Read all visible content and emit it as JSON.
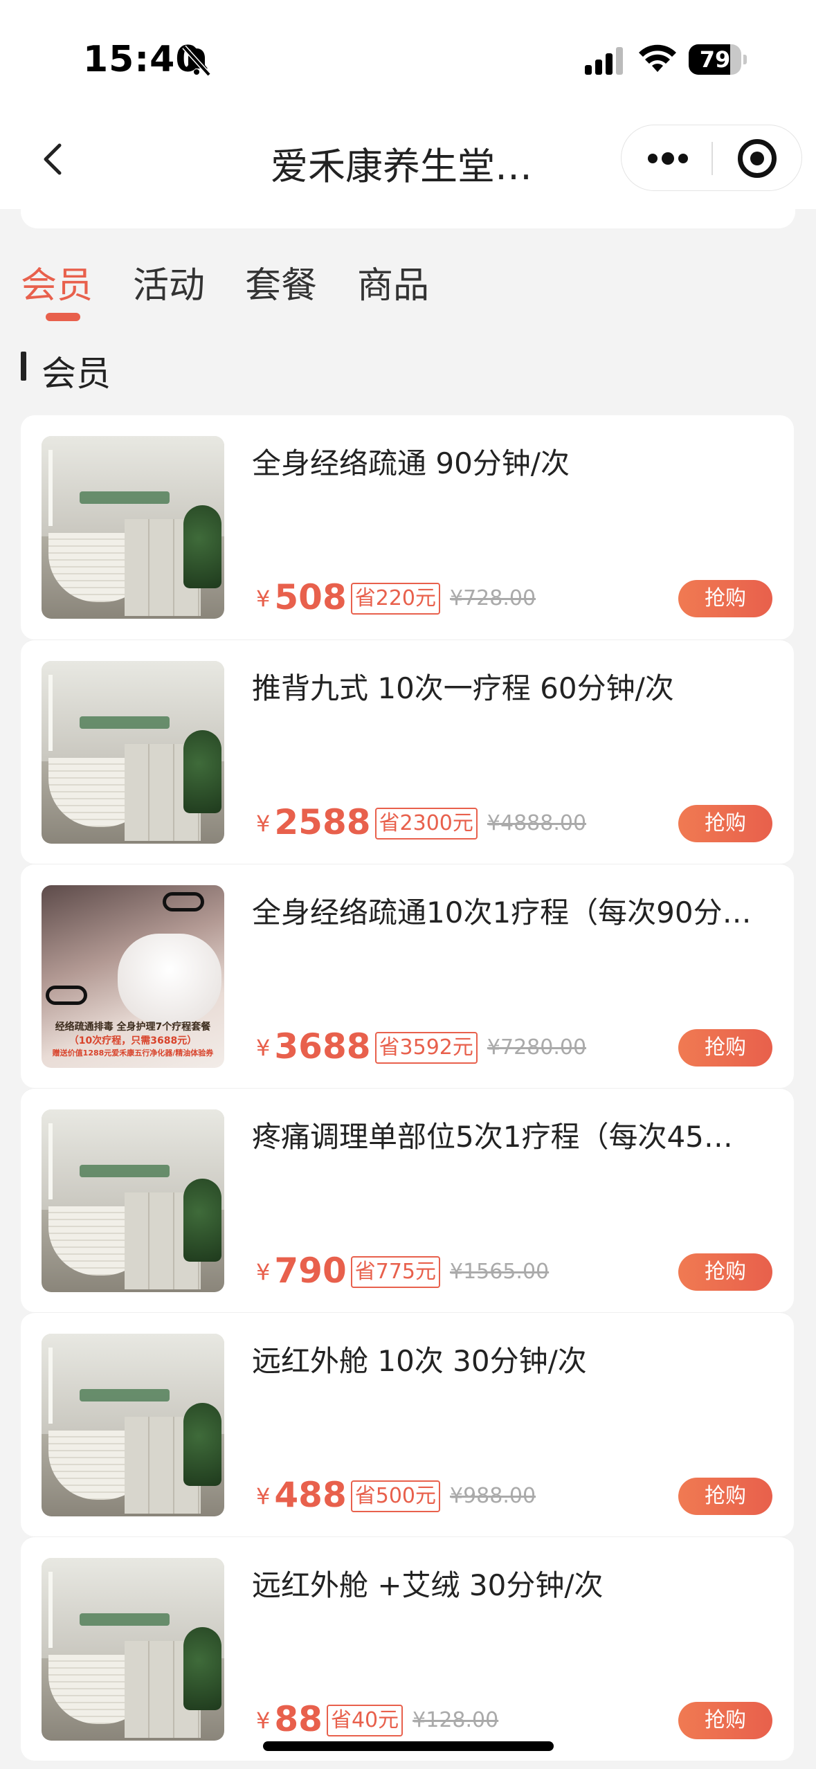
{
  "status_bar": {
    "time": "15:40",
    "battery": "79",
    "battery_level": 0.79
  },
  "nav": {
    "title": "爱禾康养生堂…"
  },
  "tabs": [
    {
      "label": "会员",
      "active": true
    },
    {
      "label": "活动",
      "active": false
    },
    {
      "label": "套餐",
      "active": false
    },
    {
      "label": "商品",
      "active": false
    }
  ],
  "section": {
    "title": "会员"
  },
  "currency_symbol": "¥",
  "buy_label": "抢购",
  "products": [
    {
      "title": "全身经络疏通 90分钟/次",
      "price": "508",
      "save": "省220元",
      "original": "¥728.00",
      "image": "lobby-photo"
    },
    {
      "title": "推背九式 10次一疗程 60分钟/次",
      "price": "2588",
      "save": "省2300元",
      "original": "¥4888.00",
      "image": "lobby-photo"
    },
    {
      "title": "全身经络疏通10次1疗程（每次90分…",
      "price": "3688",
      "save": "省3592元",
      "original": "¥7280.00",
      "image": "promo-photo",
      "image_caption_1": "经络疏通排毒 全身护理7个疗程套餐",
      "image_caption_2": "（10次疗程，只需3688元）",
      "image_caption_3": "赠送价值1288元爱禾康五行净化器/精油体验券"
    },
    {
      "title": "疼痛调理单部位5次1疗程（每次45…",
      "price": "790",
      "save": "省775元",
      "original": "¥1565.00",
      "image": "lobby-photo"
    },
    {
      "title": "远红外舱 10次 30分钟/次",
      "price": "488",
      "save": "省500元",
      "original": "¥988.00",
      "image": "lobby-photo"
    },
    {
      "title": "远红外舱 +艾绒 30分钟/次",
      "price": "88",
      "save": "省40元",
      "original": "¥128.00",
      "image": "lobby-photo"
    }
  ],
  "colors": {
    "accent": "#e8604c",
    "background": "#f3f3f3"
  }
}
